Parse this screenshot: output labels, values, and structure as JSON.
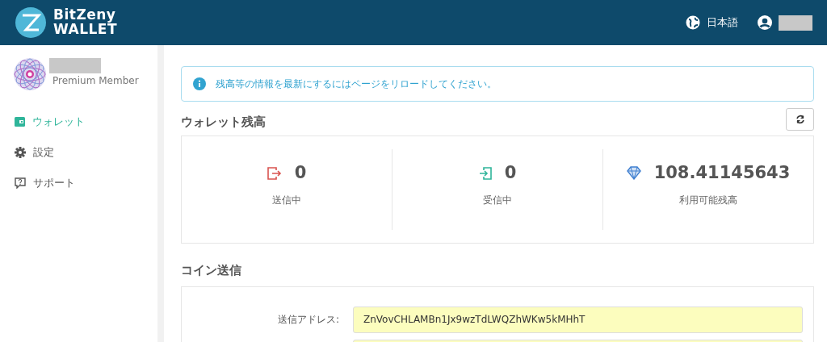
{
  "header": {
    "logo": {
      "line1": "BitZeny",
      "line2": "WALLET"
    },
    "language": "日本語"
  },
  "sidebar": {
    "member_label": "Premium Member",
    "items": [
      {
        "label": "ウォレット",
        "kind": "wallet",
        "selected": true
      },
      {
        "label": "設定",
        "kind": "settings",
        "selected": false
      },
      {
        "label": "サポート",
        "kind": "support",
        "selected": false
      }
    ]
  },
  "alert": "残高等の情報を最新にするにはページをリロードしてください。",
  "balance": {
    "title": "ウォレット残高",
    "stats": [
      {
        "kind": "sending",
        "value": "0",
        "label": "送信中"
      },
      {
        "kind": "receiving",
        "value": "0",
        "label": "受信中"
      },
      {
        "kind": "available",
        "value": "108.41145643",
        "label": "利用可能残高"
      }
    ]
  },
  "send": {
    "title": "コイン送信",
    "fields": [
      {
        "label": "送信アドレス:",
        "value": "ZnVovCHLAMBn1Jx9wzTdLWQZhWKw5kMHhT"
      }
    ]
  }
}
